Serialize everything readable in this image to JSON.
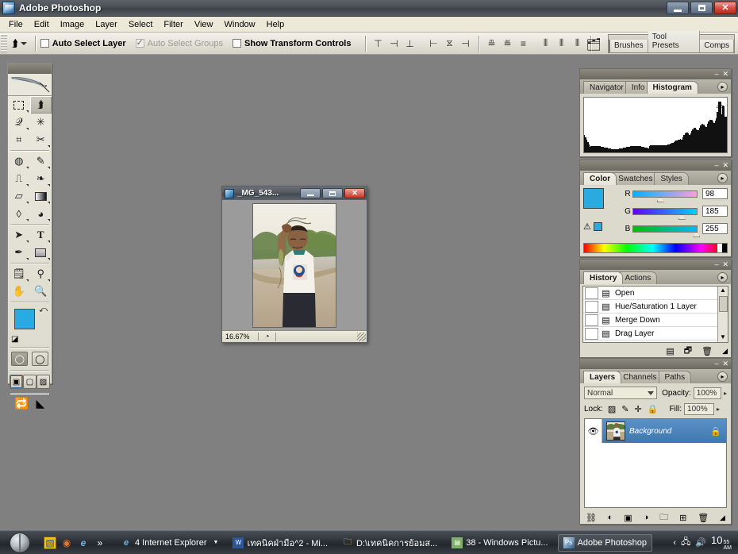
{
  "app": {
    "title": "Adobe Photoshop",
    "icon": "photoshop-icon"
  },
  "window_controls": {
    "minimize": "–",
    "restore": "❐",
    "close": "✕"
  },
  "menubar": {
    "items": [
      "File",
      "Edit",
      "Image",
      "Layer",
      "Select",
      "Filter",
      "View",
      "Window",
      "Help"
    ]
  },
  "options_bar": {
    "tool": "move-tool",
    "checkboxes": [
      {
        "label": "Auto Select Layer",
        "checked": false,
        "enabled": true
      },
      {
        "label": "Auto Select Groups",
        "checked": true,
        "enabled": false
      },
      {
        "label": "Show Transform Controls",
        "checked": false,
        "enabled": true
      }
    ],
    "align_buttons": [
      "align-top-edges",
      "align-vertical-centers",
      "align-bottom-edges",
      "align-left-edges",
      "align-horizontal-centers",
      "align-right-edges"
    ],
    "distribute_buttons": [
      "distribute-top-edges",
      "distribute-vertical-centers",
      "distribute-bottom-edges",
      "distribute-left-edges",
      "distribute-horizontal-centers",
      "distribute-right-edges"
    ],
    "file_browser_icon": "file-browser-icon",
    "palette_well": [
      "Brushes",
      "Tool Presets",
      "Comps"
    ]
  },
  "toolbox": {
    "tools": [
      {
        "name": "rectangular-marquee-tool",
        "glyph": "⬚",
        "selected": false,
        "has_flyout": true
      },
      {
        "name": "move-tool",
        "glyph": "⬈",
        "selected": true,
        "has_flyout": false
      },
      {
        "name": "lasso-tool",
        "glyph": "𝒪",
        "selected": false,
        "has_flyout": true
      },
      {
        "name": "magic-wand-tool",
        "glyph": "✳",
        "selected": false,
        "has_flyout": false
      },
      {
        "name": "crop-tool",
        "glyph": "⌗",
        "selected": false,
        "has_flyout": false
      },
      {
        "name": "slice-tool",
        "glyph": "✂",
        "selected": false,
        "has_flyout": true
      },
      {
        "name": "healing-brush-tool",
        "glyph": "◍",
        "selected": false,
        "has_flyout": true
      },
      {
        "name": "brush-tool",
        "glyph": "✎",
        "selected": false,
        "has_flyout": true
      },
      {
        "name": "clone-stamp-tool",
        "glyph": "⎙",
        "selected": false,
        "has_flyout": true
      },
      {
        "name": "history-brush-tool",
        "glyph": "❧",
        "selected": false,
        "has_flyout": true
      },
      {
        "name": "eraser-tool",
        "glyph": "▱",
        "selected": false,
        "has_flyout": true
      },
      {
        "name": "gradient-tool",
        "glyph": "▤",
        "selected": false,
        "has_flyout": true
      },
      {
        "name": "blur-tool",
        "glyph": "💧",
        "selected": false,
        "has_flyout": true
      },
      {
        "name": "dodge-tool",
        "glyph": "●",
        "selected": false,
        "has_flyout": true
      },
      {
        "name": "path-selection-tool",
        "glyph": "➤",
        "selected": false,
        "has_flyout": true
      },
      {
        "name": "type-tool",
        "glyph": "T",
        "selected": false,
        "has_flyout": true
      },
      {
        "name": "pen-tool",
        "glyph": "✒",
        "selected": false,
        "has_flyout": true
      },
      {
        "name": "rectangle-shape-tool",
        "glyph": "▭",
        "selected": false,
        "has_flyout": true
      },
      {
        "name": "notes-tool",
        "glyph": "🗒",
        "selected": false,
        "has_flyout": true
      },
      {
        "name": "eyedropper-tool",
        "glyph": "⚲",
        "selected": false,
        "has_flyout": true
      },
      {
        "name": "hand-tool",
        "glyph": "✋",
        "selected": false,
        "has_flyout": false
      },
      {
        "name": "zoom-tool",
        "glyph": "🔍",
        "selected": false,
        "has_flyout": false
      }
    ],
    "foreground_color": "#29abe2",
    "background_color": "#ffffff",
    "swap_colors_icon": "swap-colors-icon",
    "default_colors_icon": "default-colors-icon",
    "mask_modes": [
      "standard-mode",
      "quick-mask-mode"
    ],
    "screen_modes": [
      "standard-screen-mode",
      "full-screen-with-menubar-mode",
      "full-screen-mode"
    ],
    "jump_to_imageready_icon": "jump-to-imageready-icon"
  },
  "document": {
    "title": "_MG_543...",
    "zoom": "16.67%",
    "status_icon": "doc-sizes-icon",
    "controls": {
      "minimize": "–",
      "maximize": "▭",
      "close": "✕"
    }
  },
  "histogram_palette": {
    "tabs": [
      "Navigator",
      "Info",
      "Histogram"
    ],
    "active_tab": "Histogram",
    "warning_icon": "cached-data-warning-icon",
    "menu_icon": "palette-menu-icon"
  },
  "color_palette": {
    "tabs": [
      "Color",
      "Swatches",
      "Styles"
    ],
    "active_tab": "Color",
    "channels": [
      {
        "label": "R",
        "value": "98"
      },
      {
        "label": "G",
        "value": "185"
      },
      {
        "label": "B",
        "value": "255"
      }
    ],
    "foreground": "#29abe2",
    "background": "#ffffff",
    "gamut_warning_icon": "out-of-gamut-warning-icon",
    "menu_icon": "palette-menu-icon"
  },
  "history_palette": {
    "tabs": [
      "History",
      "Actions"
    ],
    "active_tab": "History",
    "items": [
      {
        "label": "Open",
        "icon": "history-state-icon"
      },
      {
        "label": "Hue/Saturation 1 Layer",
        "icon": "history-state-icon"
      },
      {
        "label": "Merge Down",
        "icon": "history-state-icon"
      },
      {
        "label": "Drag Layer",
        "icon": "history-state-icon"
      }
    ],
    "footer_buttons": [
      "new-document-from-state-icon",
      "new-snapshot-icon",
      "delete-state-icon"
    ],
    "menu_icon": "palette-menu-icon"
  },
  "layers_palette": {
    "tabs": [
      "Layers",
      "Channels",
      "Paths"
    ],
    "active_tab": "Layers",
    "blend_mode": "Normal",
    "opacity_label": "Opacity:",
    "opacity_value": "100%",
    "lock_label": "Lock:",
    "lock_icons": [
      "lock-transparent-pixels-icon",
      "lock-image-pixels-icon",
      "lock-position-icon",
      "lock-all-icon"
    ],
    "fill_label": "Fill:",
    "fill_value": "100%",
    "layers": [
      {
        "name": "Background",
        "visible": true,
        "locked": true,
        "selected": true
      }
    ],
    "footer_buttons": [
      "link-layers-icon",
      "layer-style-icon",
      "layer-mask-icon",
      "adjustment-layer-icon",
      "new-group-icon",
      "new-layer-icon",
      "delete-layer-icon"
    ],
    "menu_icon": "palette-menu-icon"
  },
  "taskbar": {
    "start_icon": "start-orb-icon",
    "quick_launch": [
      "show-desktop-icon",
      "firefox-icon",
      "internet-explorer-icon",
      "quick-launch-overflow-icon"
    ],
    "items": [
      {
        "label": "4 Internet Explorer",
        "icon": "internet-explorer-icon",
        "grouped": true,
        "active": false
      },
      {
        "label": "เทคนิคฝ่ามือ^2 - Mi...",
        "icon": "word-icon",
        "grouped": false,
        "active": false
      },
      {
        "label": "D:\\เทคนิคการย้อมส...",
        "icon": "folder-icon",
        "grouped": false,
        "active": false
      },
      {
        "label": "38 - Windows Pictu...",
        "icon": "picture-viewer-icon",
        "grouped": false,
        "active": false
      },
      {
        "label": "Adobe Photoshop",
        "icon": "photoshop-icon",
        "grouped": false,
        "active": true
      }
    ],
    "tray_icons": [
      "tray-expand-icon",
      "tray-network-icon",
      "tray-volume-icon"
    ],
    "clock_time": "10",
    "clock_minutes": "55",
    "clock_meridiem": "AM"
  }
}
